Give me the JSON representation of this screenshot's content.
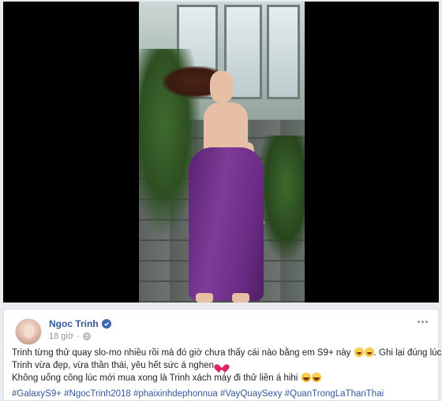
{
  "post": {
    "author": "Ngoc Trinh",
    "time": "18 giờ",
    "text_line1": "Trinh từng thử quay slo-mo nhiều rồi mà đó giờ chưa thấy cái nào bằng em S9+ này",
    "text_line1_tail": ". Ghi lại đúng lúc",
    "text_line2": "Trinh vừa đẹp, vừa thần thái, yêu hết sức á nghen",
    "text_line3": "Không uổng công lúc mới mua xong là Trinh xách máy đi thử liền á hihi",
    "hashtags": [
      "#GalaxyS9+",
      "#NgocTrinh2018",
      "#phaixinhdephonnua",
      "#VayQuaySexy",
      "#QuanTrongLaThanThai"
    ]
  },
  "icons": {
    "verified": "verified-badge-icon",
    "globe": "globe-icon",
    "more": "more-options-icon"
  },
  "colors": {
    "link": "#365899",
    "text": "#1d2129",
    "meta": "#90949c",
    "background": "#e9ebee",
    "dress": "#7d3c98"
  }
}
